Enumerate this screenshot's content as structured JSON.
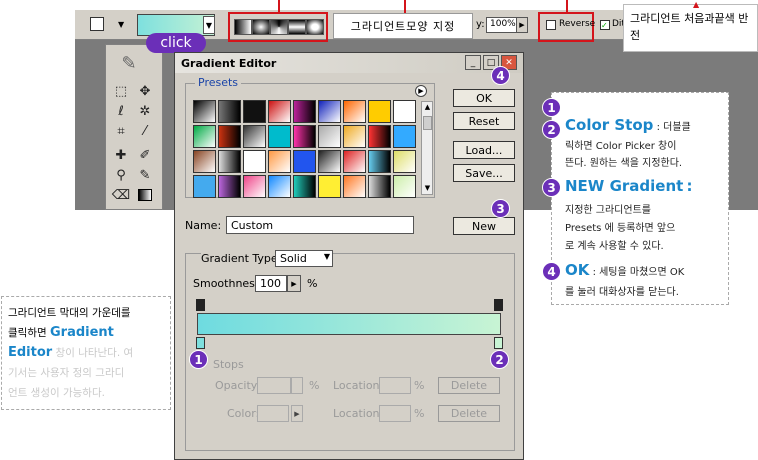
{
  "options_bar": {
    "shape_label": "그라디언트모양 지정",
    "opacity_value": "100%",
    "reverse_label": "Reverse",
    "dither_label": "Dit"
  },
  "callouts": {
    "click": "click",
    "reverse_note": "그라디언트 처음과끝색 반전"
  },
  "dialog": {
    "title": "Gradient Editor",
    "presets_label": "Presets",
    "buttons": {
      "ok": "OK",
      "reset": "Reset",
      "load": "Load...",
      "save": "Save...",
      "new": "New"
    },
    "name_label": "Name:",
    "name_value": "Custom",
    "gradient_type_label": "Gradient Type:",
    "gradient_type_value": "Solid",
    "smoothness_label": "Smoothness:",
    "smoothness_value": "100",
    "smoothness_unit": "%",
    "stops_label": "Stops",
    "opacity_label": "Opacity:",
    "color_label": "Color:",
    "location_label": "Location:",
    "percent": "%",
    "delete_label": "Delete"
  },
  "annotations": {
    "n1": "1",
    "n2": "2",
    "n3": "3",
    "n4": "4",
    "color_stop_title": "Color Stop",
    "color_stop_text_a": ": 더블클",
    "color_stop_text_b": "릭하면 Color Picker 창이",
    "color_stop_text_c": "뜬다. 원하는 색을 지정한다.",
    "new_gradient_title": "NEW Gradient",
    "new_gradient_text_a": "지정한 그라디언트를",
    "new_gradient_text_b": "Presets 에 등록하면 앞으",
    "new_gradient_text_c": "로 계속 사용할 수 있다.",
    "ok_title": "OK",
    "ok_text_a": ": 세팅을 마쳤으면 OK",
    "ok_text_b": "를 눌러 대화상자를 닫는다."
  },
  "left_note": {
    "line1": "그라디언트 막대의 가운데를",
    "line2a": "클릭하면 ",
    "highlight": "Gradient",
    "highlight2": "Editor",
    "line3_faded": "창이 나타난다. 여",
    "line4_faded": "기서는 사용자 정의 그라디",
    "line5_faded": "언트 생성이 가능하다."
  },
  "presets_colors": [
    "#000000",
    "#777777",
    "#111111",
    "#cc1111",
    "#bb2299",
    "#1122bb",
    "#ff6600",
    "#ffcc00",
    "#ffffff",
    "#00aa44",
    "#cc3311",
    "#333333",
    "#00bbcc",
    "#ff33aa",
    "#aaaaaa",
    "#eeaa22",
    "#ff3333",
    "#33aaff",
    "#884422",
    "#dddddd",
    "#ffffff",
    "#ff9944",
    "#2255ee",
    "#222222",
    "#dd2222",
    "#66ccee",
    "#dddd66",
    "#44aaee",
    "#bb66dd",
    "#ee4488",
    "#1188ff",
    "#22ccbb",
    "#ffee33",
    "#ff7722",
    "#dddddd",
    "#cceeaa"
  ]
}
